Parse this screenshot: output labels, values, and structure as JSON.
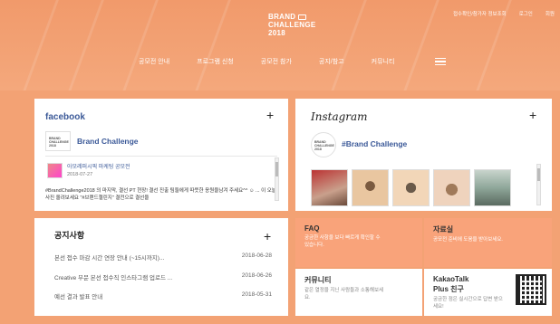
{
  "header": {
    "top_links": [
      "접수확인/참가자 정보조회",
      "로그인",
      "회원"
    ],
    "logo_lines": [
      "BRAND",
      "CHALLENGE",
      "2018"
    ],
    "nav": [
      "공모전 안내",
      "프로그램 신청",
      "공모전 참가",
      "공지/참고",
      "커뮤니티"
    ]
  },
  "facebook": {
    "title": "facebook",
    "page_name": "Brand Challenge",
    "logo_text": "BRAND CHALLENGE 2018",
    "post": {
      "author": "아모레퍼시픽 마케팅 공모전",
      "date": "2018-07-27",
      "body": "#BrandChallenge2018 의 마지막, 결선 PT 현장! 결선 진출 팀들에게 따뜻한 응원을남겨 주세요^^ ☺ ... 이 오늘 사진 올려보세요 \"#브랜드챌린지\" 결전으로 결선을"
    }
  },
  "instagram": {
    "title": "Instagram",
    "account": "#Brand Challenge",
    "logo_text": "BRAND CHALLENGE 2018",
    "photo_colors": [
      "#c9a08c",
      "#e9c6a0",
      "#f2d6b8",
      "#efd3bd",
      "#8fa79a"
    ]
  },
  "notice": {
    "title": "공지사항",
    "items": [
      {
        "text": "본선 접수 마감 시간 연장 안내 (~15시까지)...",
        "date": "2018-06-28"
      },
      {
        "text": "Creative 부문 본선 접수직 인스타그램 업로드 ...",
        "date": "2018-06-26"
      },
      {
        "text": "예선 결과 발표 안내",
        "date": "2018-05-31"
      }
    ]
  },
  "tiles": {
    "faq": {
      "title": "FAQ",
      "desc": "궁금한 사항을 보다 빠르게 확인할 수 있습니다."
    },
    "resources": {
      "title": "자료실",
      "desc": "공모전 준비에 도움을 받아보세요."
    },
    "community": {
      "title": "커뮤니티",
      "desc": "같은 열정을 지닌 사람들과 소통해보세요."
    },
    "kakao": {
      "title_line1": "KakaoTalk",
      "title_line2": "Plus 친구",
      "desc": "궁금한 점은 실시간으로 답변 받으세요!"
    }
  },
  "colors": {
    "accent": "#f3a274",
    "facebook": "#3b5998"
  }
}
